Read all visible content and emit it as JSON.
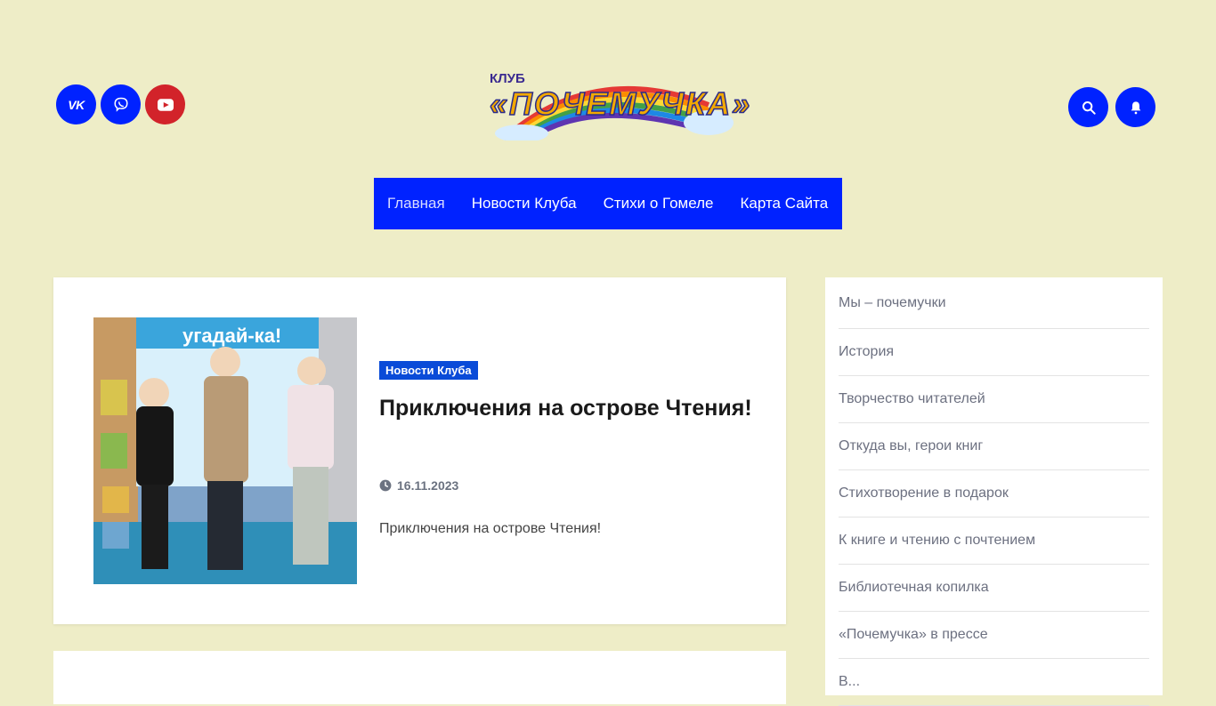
{
  "header": {
    "logo_klub": "КЛУБ",
    "logo_main": "«ПОЧЕМУЧКА»",
    "social": [
      "vk-icon",
      "viber-icon",
      "youtube-icon"
    ],
    "actions": [
      "search-icon",
      "bell-icon"
    ]
  },
  "nav": {
    "items": [
      "Главная",
      "Новости Клуба",
      "Стихи о Гомеле",
      "Карта Сайта"
    ]
  },
  "post": {
    "category": "Новости Клуба",
    "title": "Приключения на острове Чтения!",
    "date": "16.11.2023",
    "excerpt": "Приключения на острове Чтения!",
    "photo_banner": "угадай-ка!"
  },
  "sidebar": {
    "items": [
      "Мы – почемучки",
      "История",
      "Творчество читателей",
      "Откуда вы, герои книг",
      "Стихотворение в подарок",
      "К книге и чтению с почтением",
      "Библиотечная копилка",
      "«Почемучка» в прессе",
      "В..."
    ]
  },
  "colors": {
    "background": "#eeedc7",
    "accent": "#0022ff",
    "youtube": "#d2232a",
    "category": "#0a4bd8"
  }
}
